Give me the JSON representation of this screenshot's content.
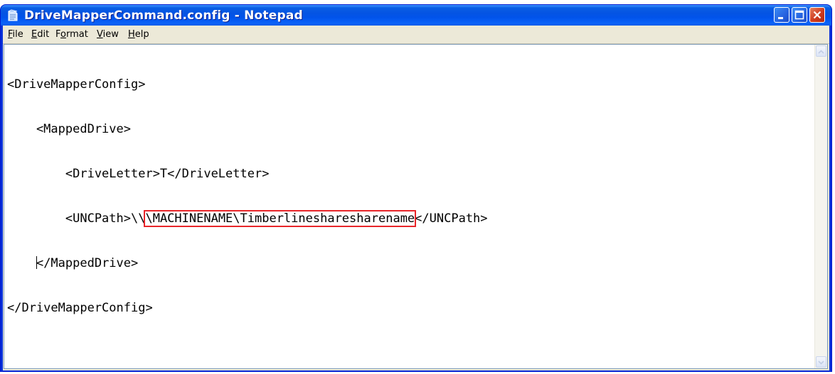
{
  "window": {
    "title": "DriveMapperCommand.config - Notepad",
    "accent": "#0a5ee3",
    "close_color": "#cf3a1e"
  },
  "menu": {
    "items": [
      {
        "label": "File",
        "hotkey": "F"
      },
      {
        "label": "Edit",
        "hotkey": "E"
      },
      {
        "label": "Format",
        "hotkey": "o"
      },
      {
        "label": "View",
        "hotkey": "V"
      },
      {
        "label": "Help",
        "hotkey": "H"
      }
    ]
  },
  "editor": {
    "lines": [
      "<DriveMapperConfig>",
      "    <MappedDrive>",
      "        <DriveLetter>T</DriveLetter>",
      {
        "before": "        <UNCPath>\\\\",
        "highlight": "\\MACHINENAME\\Timberlinesharesharename",
        "after": "</UNCPath>"
      },
      "    </MappedDrive>",
      "</DriveMapperConfig>"
    ],
    "highlight_color": "#e8262a"
  },
  "icons": {
    "app": "notepad-icon",
    "minimize": "minimize-icon",
    "maximize": "maximize-icon",
    "close": "close-icon",
    "scroll_up": "chevron-up-icon",
    "scroll_down": "chevron-down-icon"
  }
}
